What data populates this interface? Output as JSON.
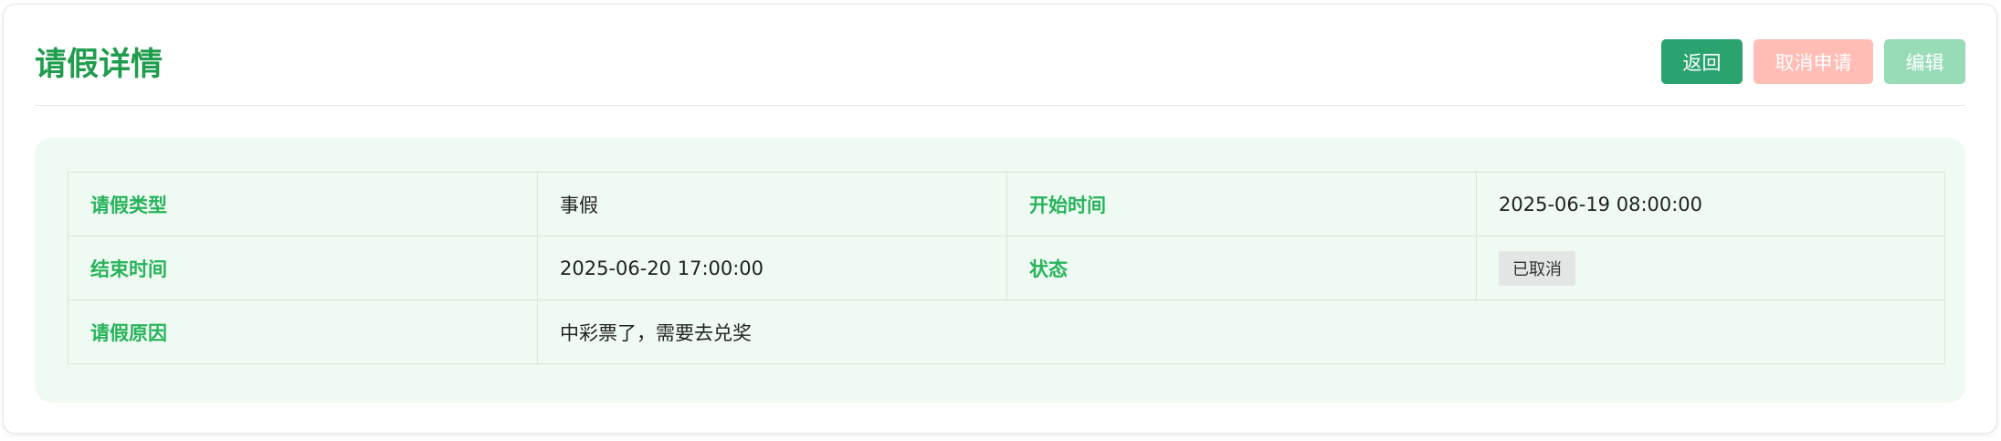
{
  "page": {
    "title": "请假详情"
  },
  "toolbar": {
    "back_label": "返回",
    "cancel_label": "取消申请",
    "edit_label": "编辑"
  },
  "details": {
    "leave_type_label": "请假类型",
    "leave_type_value": "事假",
    "start_time_label": "开始时间",
    "start_time_value": "2025-06-19 08:00:00",
    "end_time_label": "结束时间",
    "end_time_value": "2025-06-20 17:00:00",
    "status_label": "状态",
    "status_value": "已取消",
    "reason_label": "请假原因",
    "reason_value": "中彩票了，需要去兑奖"
  },
  "colors": {
    "title_green": "#1f9d4c",
    "label_green": "#27b35b",
    "back_button": "#2ba36e",
    "cancel_button_disabled": "#ffbdb6",
    "edit_button_disabled": "#98dcb7",
    "panel_background": "#effbf2"
  }
}
